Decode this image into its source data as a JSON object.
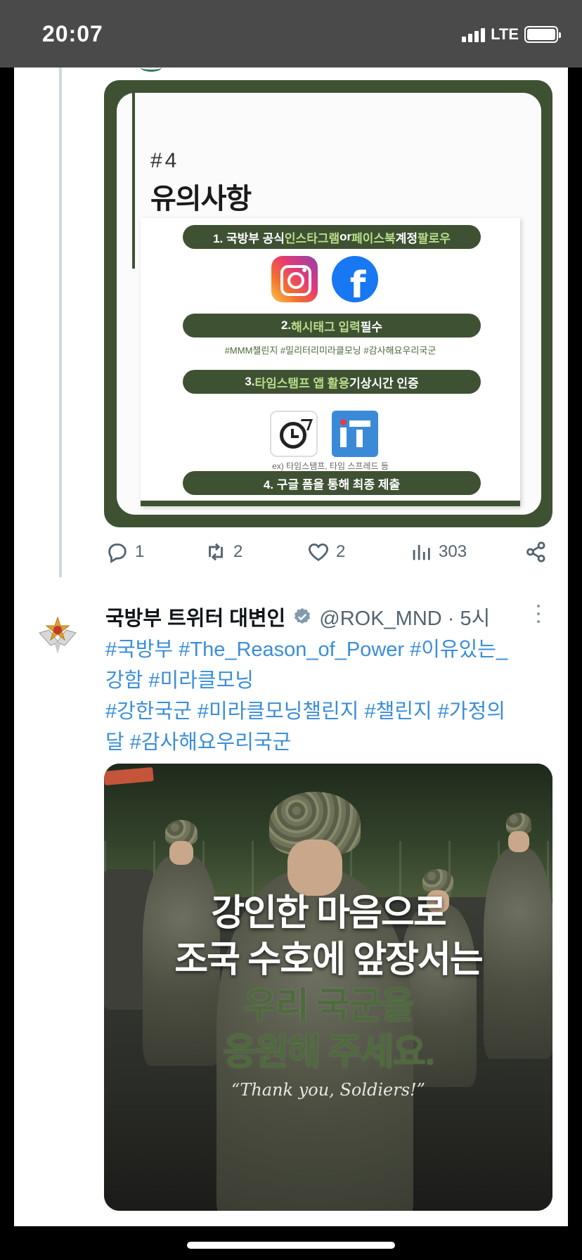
{
  "status_bar": {
    "time": "20:07",
    "network": "LTE",
    "battery_level": 1.0
  },
  "infographic": {
    "number": "#4",
    "title": "유의사항",
    "step1": {
      "num": "1. 국방부 공식 ",
      "insta": "인스타그램",
      "or": " or ",
      "fb": "페이스북",
      "mid": " 계정 ",
      "end": "팔로우"
    },
    "step2": {
      "num": "2. ",
      "hashtag": "해시태그 입력",
      "end": "필수"
    },
    "hashtag_note": "#MMM챌린지 #밀리터리미라클모닝 #감사해요우리국군",
    "step3": {
      "num": "3. ",
      "app": "타임스탬프 앱 활용",
      "end": " 기상시간 인증"
    },
    "app_note": "ex) 타임스탬프, 타임 스프레드 등",
    "step4": "4. 구글 폼을 통해 최종 제출",
    "icons": [
      "instagram-icon",
      "facebook-icon",
      "clock-app-icon",
      "timestamp-app-icon"
    ]
  },
  "tweet1_actions": {
    "replies": "1",
    "retweets": "2",
    "likes": "2",
    "views": "303"
  },
  "tweet2": {
    "name": "국방부 트위터 대변인",
    "handle": "@ROK_MND · 5시",
    "text_line1": "#국방부 #The_Reason_of_Power #이유있는_",
    "text_line2": "강함 #미라클모닝",
    "text_line3": "#강한국군 #미라클모닝챌린지 #챌린지 #가정의",
    "text_line4": "달 #감사해요우리국군"
  },
  "photo": {
    "line1": "강인한 마음으로",
    "line2": "조국 수호에 앞장서는",
    "line3": "우리 국군을",
    "line4": "응원해 주세요.",
    "quote": "“Thank you, Soldiers!”"
  },
  "colors": {
    "army_green": "#3e5233",
    "light_green": "#b9dc8a",
    "link_blue": "#3a8ed8",
    "muted": "#536471"
  }
}
